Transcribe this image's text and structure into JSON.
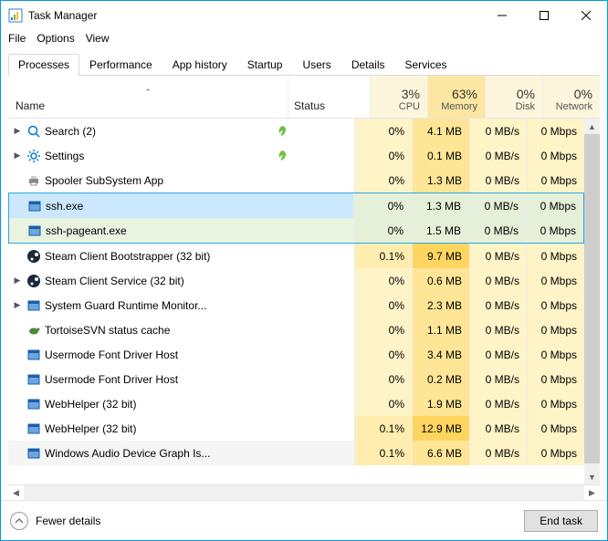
{
  "window": {
    "title": "Task Manager"
  },
  "menu": {
    "file": "File",
    "options": "Options",
    "view": "View"
  },
  "tabs": [
    {
      "label": "Processes",
      "active": true
    },
    {
      "label": "Performance"
    },
    {
      "label": "App history"
    },
    {
      "label": "Startup"
    },
    {
      "label": "Users"
    },
    {
      "label": "Details"
    },
    {
      "label": "Services"
    }
  ],
  "columns": {
    "name": "Name",
    "status": "Status",
    "cpu": {
      "pct": "3%",
      "label": "CPU"
    },
    "mem": {
      "pct": "63%",
      "label": "Memory"
    },
    "disk": {
      "pct": "0%",
      "label": "Disk"
    },
    "net": {
      "pct": "0%",
      "label": "Network"
    }
  },
  "rows": [
    {
      "exp": true,
      "icon": "search",
      "name": "Search (2)",
      "leaf": true,
      "cpu": "0%",
      "mem": "4.1 MB",
      "disk": "0 MB/s",
      "net": "0 Mbps"
    },
    {
      "exp": true,
      "icon": "gear",
      "name": "Settings",
      "leaf": true,
      "cpu": "0%",
      "mem": "0.1 MB",
      "disk": "0 MB/s",
      "net": "0 Mbps"
    },
    {
      "exp": false,
      "icon": "printer",
      "name": "Spooler SubSystem App",
      "cpu": "0%",
      "mem": "1.3 MB",
      "disk": "0 MB/s",
      "net": "0 Mbps"
    },
    {
      "exp": false,
      "icon": "app",
      "name": "ssh.exe",
      "cpu": "0%",
      "mem": "1.3 MB",
      "disk": "0 MB/s",
      "net": "0 Mbps",
      "selected": 1
    },
    {
      "exp": false,
      "icon": "app",
      "name": "ssh-pageant.exe",
      "cpu": "0%",
      "mem": "1.5 MB",
      "disk": "0 MB/s",
      "net": "0 Mbps",
      "selected": 2
    },
    {
      "exp": false,
      "icon": "steam",
      "name": "Steam Client Bootstrapper (32 bit)",
      "cpu": "0.1%",
      "cpuwarm": true,
      "mem": "9.7 MB",
      "memhot": true,
      "disk": "0 MB/s",
      "net": "0 Mbps"
    },
    {
      "exp": true,
      "icon": "steam",
      "name": "Steam Client Service (32 bit)",
      "cpu": "0%",
      "mem": "0.6 MB",
      "disk": "0 MB/s",
      "net": "0 Mbps"
    },
    {
      "exp": true,
      "icon": "app",
      "name": "System Guard Runtime Monitor...",
      "cpu": "0%",
      "mem": "2.3 MB",
      "disk": "0 MB/s",
      "net": "0 Mbps"
    },
    {
      "exp": false,
      "icon": "tortoise",
      "name": "TortoiseSVN status cache",
      "cpu": "0%",
      "mem": "1.1 MB",
      "disk": "0 MB/s",
      "net": "0 Mbps"
    },
    {
      "exp": false,
      "icon": "app",
      "name": "Usermode Font Driver Host",
      "cpu": "0%",
      "mem": "3.4 MB",
      "disk": "0 MB/s",
      "net": "0 Mbps"
    },
    {
      "exp": false,
      "icon": "app",
      "name": "Usermode Font Driver Host",
      "cpu": "0%",
      "mem": "0.2 MB",
      "disk": "0 MB/s",
      "net": "0 Mbps"
    },
    {
      "exp": false,
      "icon": "app",
      "name": "WebHelper (32 bit)",
      "cpu": "0%",
      "mem": "1.9 MB",
      "disk": "0 MB/s",
      "net": "0 Mbps"
    },
    {
      "exp": false,
      "icon": "app",
      "name": "WebHelper (32 bit)",
      "cpu": "0.1%",
      "cpuwarm": true,
      "mem": "12.9 MB",
      "memhot": true,
      "disk": "0 MB/s",
      "net": "0 Mbps"
    },
    {
      "exp": false,
      "icon": "app",
      "name": "Windows Audio Device Graph Is...",
      "cpu": "0.1%",
      "cpuwarm": true,
      "mem": "6.6 MB",
      "disk": "0 MB/s",
      "net": "0 Mbps",
      "last": true
    }
  ],
  "footer": {
    "fewer": "Fewer details",
    "endtask": "End task"
  }
}
